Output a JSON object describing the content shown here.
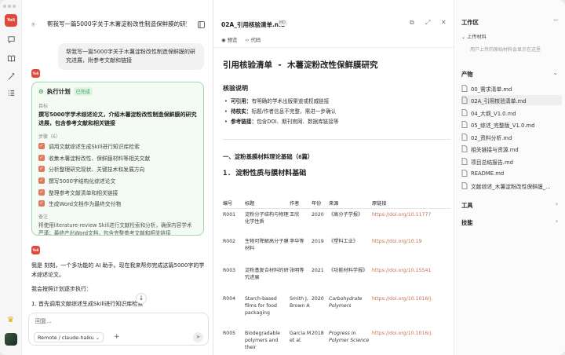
{
  "app": {
    "logo_text": "Yoli"
  },
  "chat": {
    "title": "帮我写一篇5000字关于木薯淀粉改性制造保鲜膜的研究进...",
    "user_message": "帮我写一篇5000字关于木薯淀粉改性制造保鲜膜的研究进展，附参考文献和链接",
    "plan": {
      "title": "执行计划",
      "badge": "已完成",
      "goal_label": "目标",
      "goal": "撰写5000字学术综述论文，介绍木薯淀粉改性制造保鲜膜的研究进展，包含参考文献和相关链接",
      "steps_label": "步骤（6）",
      "steps": [
        "调用文献综述生成Skill进行知识库检索",
        "收集木薯淀粉改性、保鲜膜材料等相关文献",
        "分析整理研究现状、关键技术和发展方向",
        "撰写5000字结构化综述论文",
        "整理参考文献清单和相关链接",
        "生成Word文档作为最终交付物"
      ],
      "notes_label": "备注",
      "notes": "将使用literature-review Skill进行文献检索和分析，确保内容学术严谨；最终产出Word文档，包含完整参考文献和相关链接"
    },
    "reply_line1": "我是 刻刻，一个多功能的 AI 助手。现在我来帮你完成这篇5000字的学术综述论文。",
    "reply_line2": "我会按照计划逐步执行：",
    "reply_step1": "1.   首先调用文献综述生成Skill进行知识库检索",
    "input_placeholder": "回复...",
    "model_label": "Remote / claude-haiku",
    "plus_label": "+",
    "send_label": "➤"
  },
  "doc": {
    "filename": "02A_引用核验清单.md",
    "badge": "MD",
    "tab_preview": "预览",
    "tab_code": "代码",
    "title": "引用核验清单 - 木薯淀粉改性保鲜膜研究",
    "notes_heading": "核验说明",
    "notes": [
      {
        "label": "可引用：",
        "text": "有明确的学术出版渠道或权威链接"
      },
      {
        "label": "待核实：",
        "text": "标题/作者信息不完整，需进一步确认"
      },
      {
        "label": "参考链接：",
        "text": "包含DOI、期刊官网、数据库链接等"
      }
    ],
    "section_heading": "一、淀粉基膜材料理论基础（6篇）",
    "subsection_heading": "1. 淀粉性质与膜材料基础",
    "table_headers": [
      "编号",
      "标题",
      "作者",
      "年份",
      "来源",
      "原链接"
    ],
    "rows": [
      {
        "id": "R001",
        "title": "淀粉分子结构与物理化学性质",
        "author": "王欣",
        "year": "2020",
        "source": "《高分子学报》",
        "link": "https://doi.org/10.11777",
        "italic": false
      },
      {
        "id": "R002",
        "title": "生物可降解高分子膜材料",
        "author": "李华等",
        "year": "2019",
        "source": "《塑料工业》",
        "link": "https://doi.org/10.19",
        "italic": false
      },
      {
        "id": "R003",
        "title": "淀粉基复合材料的研究进展",
        "author": "张明等",
        "year": "2021",
        "source": "《功能材料学报》",
        "link": "https://doi.org/10.15541",
        "italic": false
      },
      {
        "id": "R004",
        "title": "Starch-based films for food packaging",
        "author": "Smith J, Brown A",
        "year": "2020",
        "source": "Carbohydrate Polymers",
        "link": "https://doi.org/10.1016/j.",
        "italic": true
      },
      {
        "id": "R005",
        "title": "Biodegradable polymers and their",
        "author": "Garcia M et al.",
        "year": "2018",
        "source": "Progress in Polymer Science",
        "link": "https://doi.org/10.1016/j.",
        "italic": true
      }
    ]
  },
  "workspace": {
    "title": "工作区",
    "upload_label": "上传材料",
    "upload_desc": "用户上传的原始材料会显示在这里",
    "products_title": "产物",
    "files": [
      "00_需求清单.md",
      "02A_引用核验清单.md",
      "04_大纲_V1.0.md",
      "05_综述_完整版_V1.0.md",
      "02_资料分析.md",
      "相关链接与资源.md",
      "项目总结报告.md",
      "README.md",
      "文献综述_木薯淀粉改性保鲜膜_..."
    ],
    "tools_title": "工具",
    "skills_title": "技能"
  }
}
